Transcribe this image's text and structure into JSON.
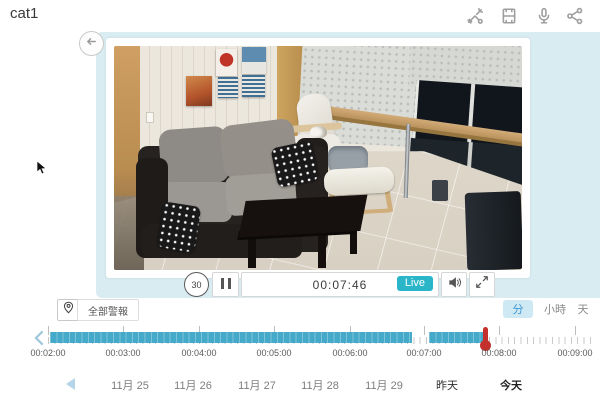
{
  "app": {
    "title": "cat1"
  },
  "header": {
    "actions": [
      "tools",
      "recordings",
      "microphone",
      "share"
    ]
  },
  "player": {
    "rewind_seconds": "30",
    "time_display": "00:07:46",
    "live_label": "Live",
    "scene_description": "Living room camera view: dark sofa with gray cushions and polka-dot pillows, black coffee table, white recliner chair with cat, white footstool, wooden counter along right wall with metal leg, patterned curtains over dark night windows, beige tiled floor, art posters on wallpapered wall."
  },
  "alerts": {
    "all_alerts_label": "全部警報"
  },
  "granularity": {
    "tabs": [
      {
        "label": "分",
        "selected": true
      },
      {
        "label": "小時",
        "selected": false
      },
      {
        "label": "天",
        "selected": false
      }
    ]
  },
  "timeline": {
    "tick_labels": [
      "00:02:00",
      "00:03:00",
      "00:04:00",
      "00:05:00",
      "00:06:00",
      "00:07:00",
      "00:08:00",
      "00:09:00"
    ],
    "recorded_segments": [
      {
        "start": "00:02:00",
        "end": "00:06:50"
      },
      {
        "start": "00:07:05",
        "end": "00:07:46"
      }
    ],
    "playhead_time": "00:07:46",
    "colors": {
      "bar": "#45a9c9",
      "playhead": "#c4302b"
    }
  },
  "date_nav": {
    "items": [
      {
        "label": "11月 25",
        "selected": false
      },
      {
        "label": "11月 26",
        "selected": false
      },
      {
        "label": "11月 27",
        "selected": false
      },
      {
        "label": "11月 28",
        "selected": false
      },
      {
        "label": "11月 29",
        "selected": false
      },
      {
        "label": "昨天",
        "selected": false
      },
      {
        "label": "今天",
        "selected": true
      }
    ]
  },
  "colors": {
    "card_bg": "#d9ecf1",
    "live_badge": "#2ab5c9",
    "tab_selected_bg": "#cfe9f4",
    "tab_selected_text": "#3e96d2"
  }
}
